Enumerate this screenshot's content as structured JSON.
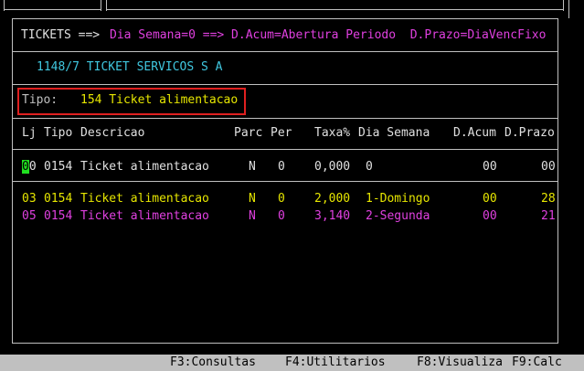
{
  "header": {
    "tickets_label": "TICKETS ==>",
    "expression": "Dia Semana=0 ==> D.Acum=Abertura Periodo  D.Prazo=DiaVencFixo"
  },
  "company": "1148/7 TICKET SERVICOS S A",
  "tipo": {
    "label": "Tipo:",
    "value": "154 Ticket alimentacao"
  },
  "table": {
    "columns": [
      "Lj",
      "Tipo",
      "Descricao",
      "Parc",
      "Per",
      "Taxa%",
      "Dia Semana",
      "D.Acum",
      "D.Prazo"
    ],
    "selected_row": {
      "lj": "00",
      "tipo": "0154",
      "desc": "Ticket alimentacao",
      "parc": "N",
      "per": "0",
      "taxa": "0,000",
      "dia": "0",
      "dacum": "00",
      "dprazo": "00"
    },
    "rows": [
      {
        "lj": "03",
        "tipo": "0154",
        "desc": "Ticket alimentacao",
        "parc": "N",
        "per": "0",
        "taxa": "2,000",
        "dia": "1-Domingo",
        "dacum": "00",
        "dprazo": "28",
        "color": "#e6e600"
      },
      {
        "lj": "05",
        "tipo": "0154",
        "desc": "Ticket alimentacao",
        "parc": "N",
        "per": "0",
        "taxa": "3,140",
        "dia": "2-Segunda",
        "dacum": "00",
        "dprazo": "21",
        "color": "#e040e0"
      }
    ]
  },
  "fkeys": [
    "F3:Consultas",
    "F4:Utilitarios",
    "F8:Visualiza",
    "F9:Calc"
  ]
}
